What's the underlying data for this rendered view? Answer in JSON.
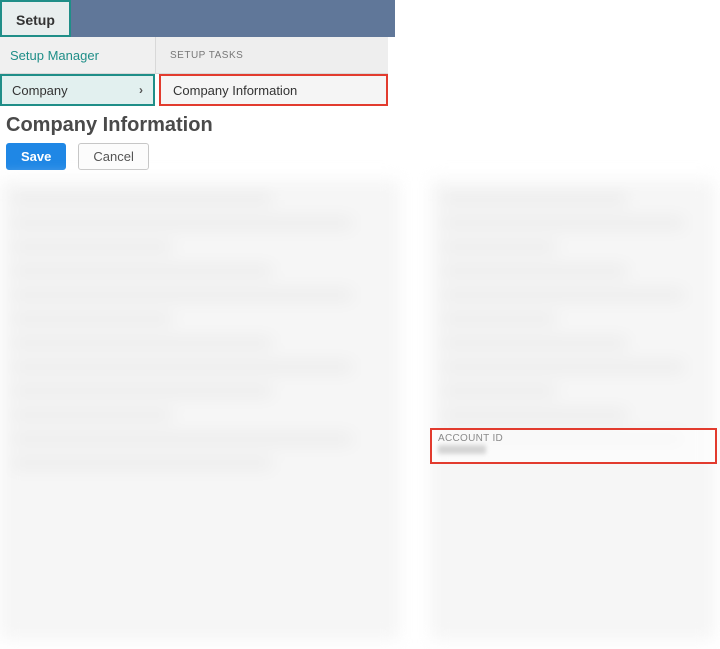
{
  "topbar": {
    "setup_tab": "Setup"
  },
  "menubar": {
    "left_label": "Setup Manager",
    "right_heading": "SETUP TASKS"
  },
  "menurow": {
    "left_label": "Company",
    "right_label": "Company Information"
  },
  "page": {
    "title": "Company Information"
  },
  "buttons": {
    "save": "Save",
    "cancel": "Cancel"
  },
  "account_id_section": {
    "label": "ACCOUNT ID"
  }
}
